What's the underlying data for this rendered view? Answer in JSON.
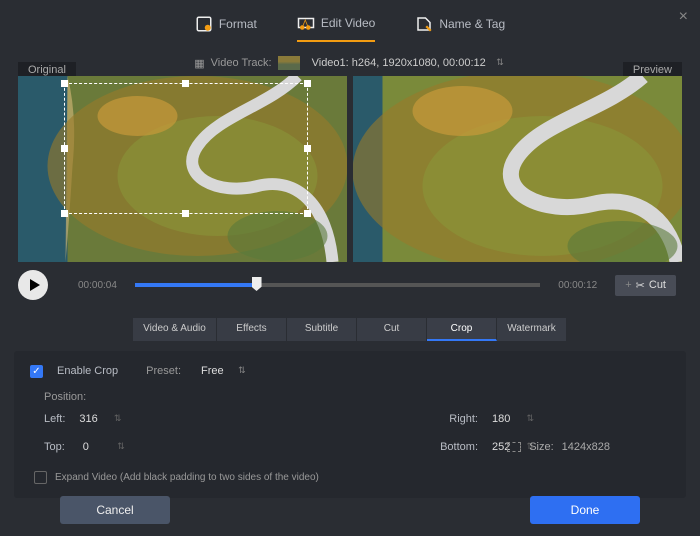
{
  "close_glyph": "×",
  "topTabs": {
    "format": "Format",
    "edit": "Edit Video",
    "name": "Name & Tag"
  },
  "videoTrack": {
    "label": "Video Track:",
    "value": "Video1: h264, 1920x1080, 00:00:12"
  },
  "panes": {
    "original": "Original",
    "preview": "Preview"
  },
  "playback": {
    "current": "00:00:04",
    "total": "00:00:12",
    "cut": "Cut",
    "scissors": "✂"
  },
  "editTabs": {
    "videoAudio": "Video & Audio",
    "effects": "Effects",
    "subtitle": "Subtitle",
    "cut": "Cut",
    "crop": "Crop",
    "watermark": "Watermark"
  },
  "crop": {
    "enable": "Enable Crop",
    "presetLabel": "Preset:",
    "presetValue": "Free",
    "position": "Position:",
    "leftLabel": "Left:",
    "leftVal": "316",
    "rightLabel": "Right:",
    "rightVal": "180",
    "topLabel": "Top:",
    "topVal": "0",
    "bottomLabel": "Bottom:",
    "bottomVal": "252",
    "sizeLabel": "Size:",
    "sizeVal": "1424x828",
    "expand": "Expand Video (Add black padding to two sides of the video)",
    "check": "✓"
  },
  "footer": {
    "cancel": "Cancel",
    "done": "Done"
  }
}
